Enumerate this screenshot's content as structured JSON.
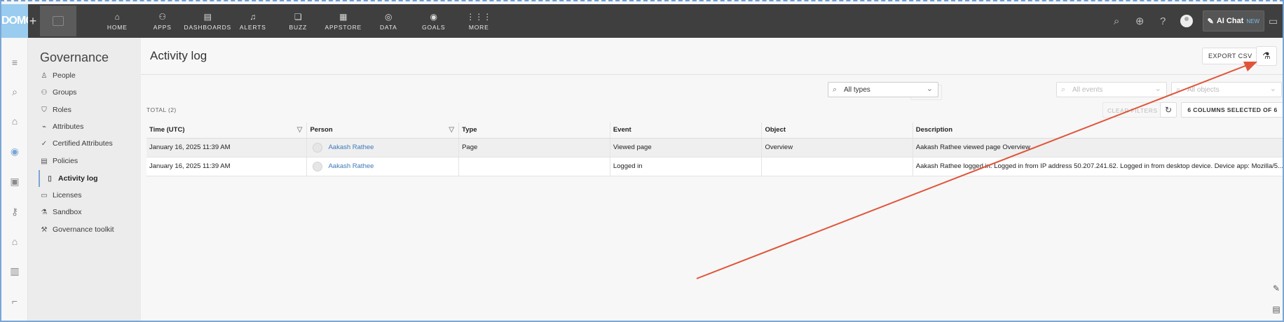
{
  "topbar": {
    "logo": "DOMO",
    "plus": "+",
    "nav": [
      {
        "label": "HOME",
        "icon": "home-icon",
        "glyph": "⌂"
      },
      {
        "label": "APPS",
        "icon": "apps-icon",
        "glyph": "⚇"
      },
      {
        "label": "DASHBOARDS",
        "icon": "dashboards-icon",
        "glyph": "▤"
      },
      {
        "label": "ALERTS",
        "icon": "alerts-icon",
        "glyph": "♫"
      },
      {
        "label": "BUZZ",
        "icon": "buzz-icon",
        "glyph": "❏"
      },
      {
        "label": "APPSTORE",
        "icon": "appstore-icon",
        "glyph": "▦"
      },
      {
        "label": "DATA",
        "icon": "data-icon",
        "glyph": "◎"
      },
      {
        "label": "GOALS",
        "icon": "goals-icon",
        "glyph": "◉"
      },
      {
        "label": "MORE",
        "icon": "more-icon",
        "glyph": "⋮⋮⋮"
      }
    ],
    "ai_chat_label": "AI Chat",
    "ai_chat_badge": "NEW"
  },
  "sidebar": {
    "title": "Governance",
    "items": [
      {
        "label": "People",
        "icon": "person-icon",
        "glyph": "♙"
      },
      {
        "label": "Groups",
        "icon": "groups-icon",
        "glyph": "⚇"
      },
      {
        "label": "Roles",
        "icon": "shield-icon",
        "glyph": "⛉"
      },
      {
        "label": "Attributes",
        "icon": "attributes-icon",
        "glyph": "⌁"
      },
      {
        "label": "Certified Attributes",
        "icon": "certified-icon",
        "glyph": "✓"
      },
      {
        "label": "Policies",
        "icon": "policies-icon",
        "glyph": "▤"
      },
      {
        "label": "Activity log",
        "icon": "document-icon",
        "glyph": "▯"
      },
      {
        "label": "Licenses",
        "icon": "licenses-icon",
        "glyph": "▭"
      },
      {
        "label": "Sandbox",
        "icon": "sandbox-icon",
        "glyph": "⚗"
      },
      {
        "label": "Governance toolkit",
        "icon": "toolkit-icon",
        "glyph": "⚒"
      }
    ]
  },
  "main": {
    "title": "Activity log",
    "export_label": "EXPORT CSV",
    "reset_label": "RESET",
    "filters": [
      {
        "value": "All types",
        "placeholder": false
      },
      {
        "value": "All events",
        "placeholder": true
      },
      {
        "value": "All objects",
        "placeholder": true
      }
    ],
    "total_label": "TOTAL (2)",
    "clear_filters_label": "CLEAR FILTERS",
    "columns_label": "6 COLUMNS SELECTED OF 6",
    "columns": [
      "Time (UTC)",
      "Person",
      "Type",
      "Event",
      "Object",
      "Description"
    ],
    "rows": [
      {
        "time": "January 16, 2025 11:39 AM",
        "person": "Aakash Rathee",
        "type": "Page",
        "event": "Viewed page",
        "object": "Overview",
        "description": "Aakash Rathee viewed page Overview"
      },
      {
        "time": "January 16, 2025 11:39 AM",
        "person": "Aakash Rathee",
        "type": "",
        "event": "Logged in",
        "object": "",
        "description": "Aakash Rathee logged in. Logged in from IP address 50.207.241.62. Logged in from desktop device. Device app: Mozilla/5..."
      }
    ]
  },
  "annotation": {
    "arrow_color": "#e0553a"
  }
}
